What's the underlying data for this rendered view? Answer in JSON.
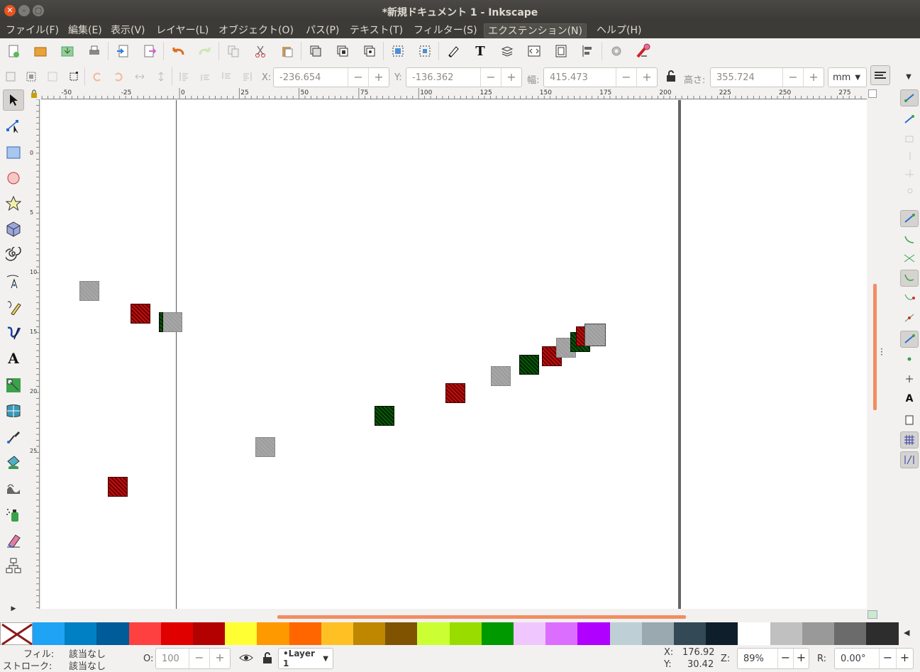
{
  "window": {
    "title": "*新規ドキュメント 1 - Inkscape"
  },
  "menu": [
    "ファイル(F)",
    "編集(E)",
    "表示(V)",
    "レイヤー(L)",
    "オブジェクト(O)",
    "パス(P)",
    "テキスト(T)",
    "フィルター(S)",
    "エクステンション(N)",
    "ヘルプ(H)"
  ],
  "controls": {
    "x_label": "X:",
    "x_value": "-236.654",
    "y_label": "Y:",
    "y_value": "-136.362",
    "w_label": "幅:",
    "w_value": "415.473",
    "h_label": "高さ:",
    "h_value": "355.724",
    "unit": "mm",
    "minus": "−",
    "plus": "+"
  },
  "ruler": {
    "h_ticks": [
      "-50",
      "-25",
      "0",
      "25",
      "50",
      "75",
      "100",
      "125",
      "150",
      "175",
      "200",
      "225",
      "250",
      "275"
    ],
    "v_ticks": [
      "0",
      "5",
      "10",
      "15",
      "20",
      "25"
    ]
  },
  "status": {
    "fill_label": "フィル:",
    "fill_value": "該当なし",
    "stroke_label": "ストローク:",
    "stroke_value": "該当なし",
    "opacity_label": "O:",
    "opacity_value": "100",
    "layer": "•Layer 1",
    "x_label": "X:",
    "cursor_x": "176.92",
    "y_label": "Y:",
    "cursor_y": "30.42",
    "zoom_label": "Z:",
    "zoom": "89%",
    "rotation_label": "R:",
    "rotation": "0.00°"
  },
  "palette": [
    "#1ea3f5",
    "#0080c4",
    "#005b99",
    "#ff4040",
    "#e00000",
    "#b30000",
    "#ffff33",
    "#ff9900",
    "#ff6600",
    "#ffc024",
    "#bf8600",
    "#805300",
    "#ccff33",
    "#99dd00",
    "#009900",
    "#f0c6ff",
    "#dc6eff",
    "#b000ff",
    "#bfcfd6",
    "#9aa8b0",
    "#334956",
    "#0e1f2b",
    "#ffffff",
    "#c0c0c0",
    "#999999",
    "#6b6b6b",
    "#2d2d2d"
  ]
}
